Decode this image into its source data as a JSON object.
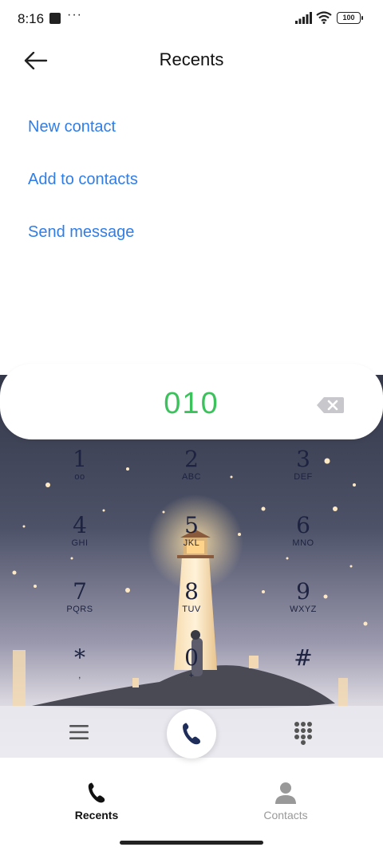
{
  "status_bar": {
    "time": "8:16",
    "dots": "···",
    "battery": "100"
  },
  "header": {
    "title": "Recents",
    "back_icon": "arrow-left-icon"
  },
  "actions": {
    "new_contact": "New contact",
    "add_to_contacts": "Add to contacts",
    "send_message": "Send message"
  },
  "dialer": {
    "number": "010",
    "backspace_icon": "backspace-icon",
    "keys": [
      {
        "digit": "1",
        "letters": "ᴏᴏ"
      },
      {
        "digit": "2",
        "letters": "ABC"
      },
      {
        "digit": "3",
        "letters": "DEF"
      },
      {
        "digit": "4",
        "letters": "GHI"
      },
      {
        "digit": "5",
        "letters": "JKL"
      },
      {
        "digit": "6",
        "letters": "MNO"
      },
      {
        "digit": "7",
        "letters": "PQRS"
      },
      {
        "digit": "8",
        "letters": "TUV"
      },
      {
        "digit": "9",
        "letters": "WXYZ"
      },
      {
        "digit": "*",
        "letters": ","
      },
      {
        "digit": "0",
        "letters": "+"
      },
      {
        "digit": "#",
        "letters": ""
      }
    ]
  },
  "bottom_actions": {
    "menu_icon": "menu-icon",
    "call_icon": "phone-icon",
    "dialpad_icon": "dialpad-icon"
  },
  "nav": {
    "recents_label": "Recents",
    "contacts_label": "Contacts"
  },
  "colors": {
    "accent": "#2f7ee8",
    "number_green": "#3cc15c",
    "sky_top": "#3b3f52",
    "sky_bottom": "#d9d7e0"
  }
}
